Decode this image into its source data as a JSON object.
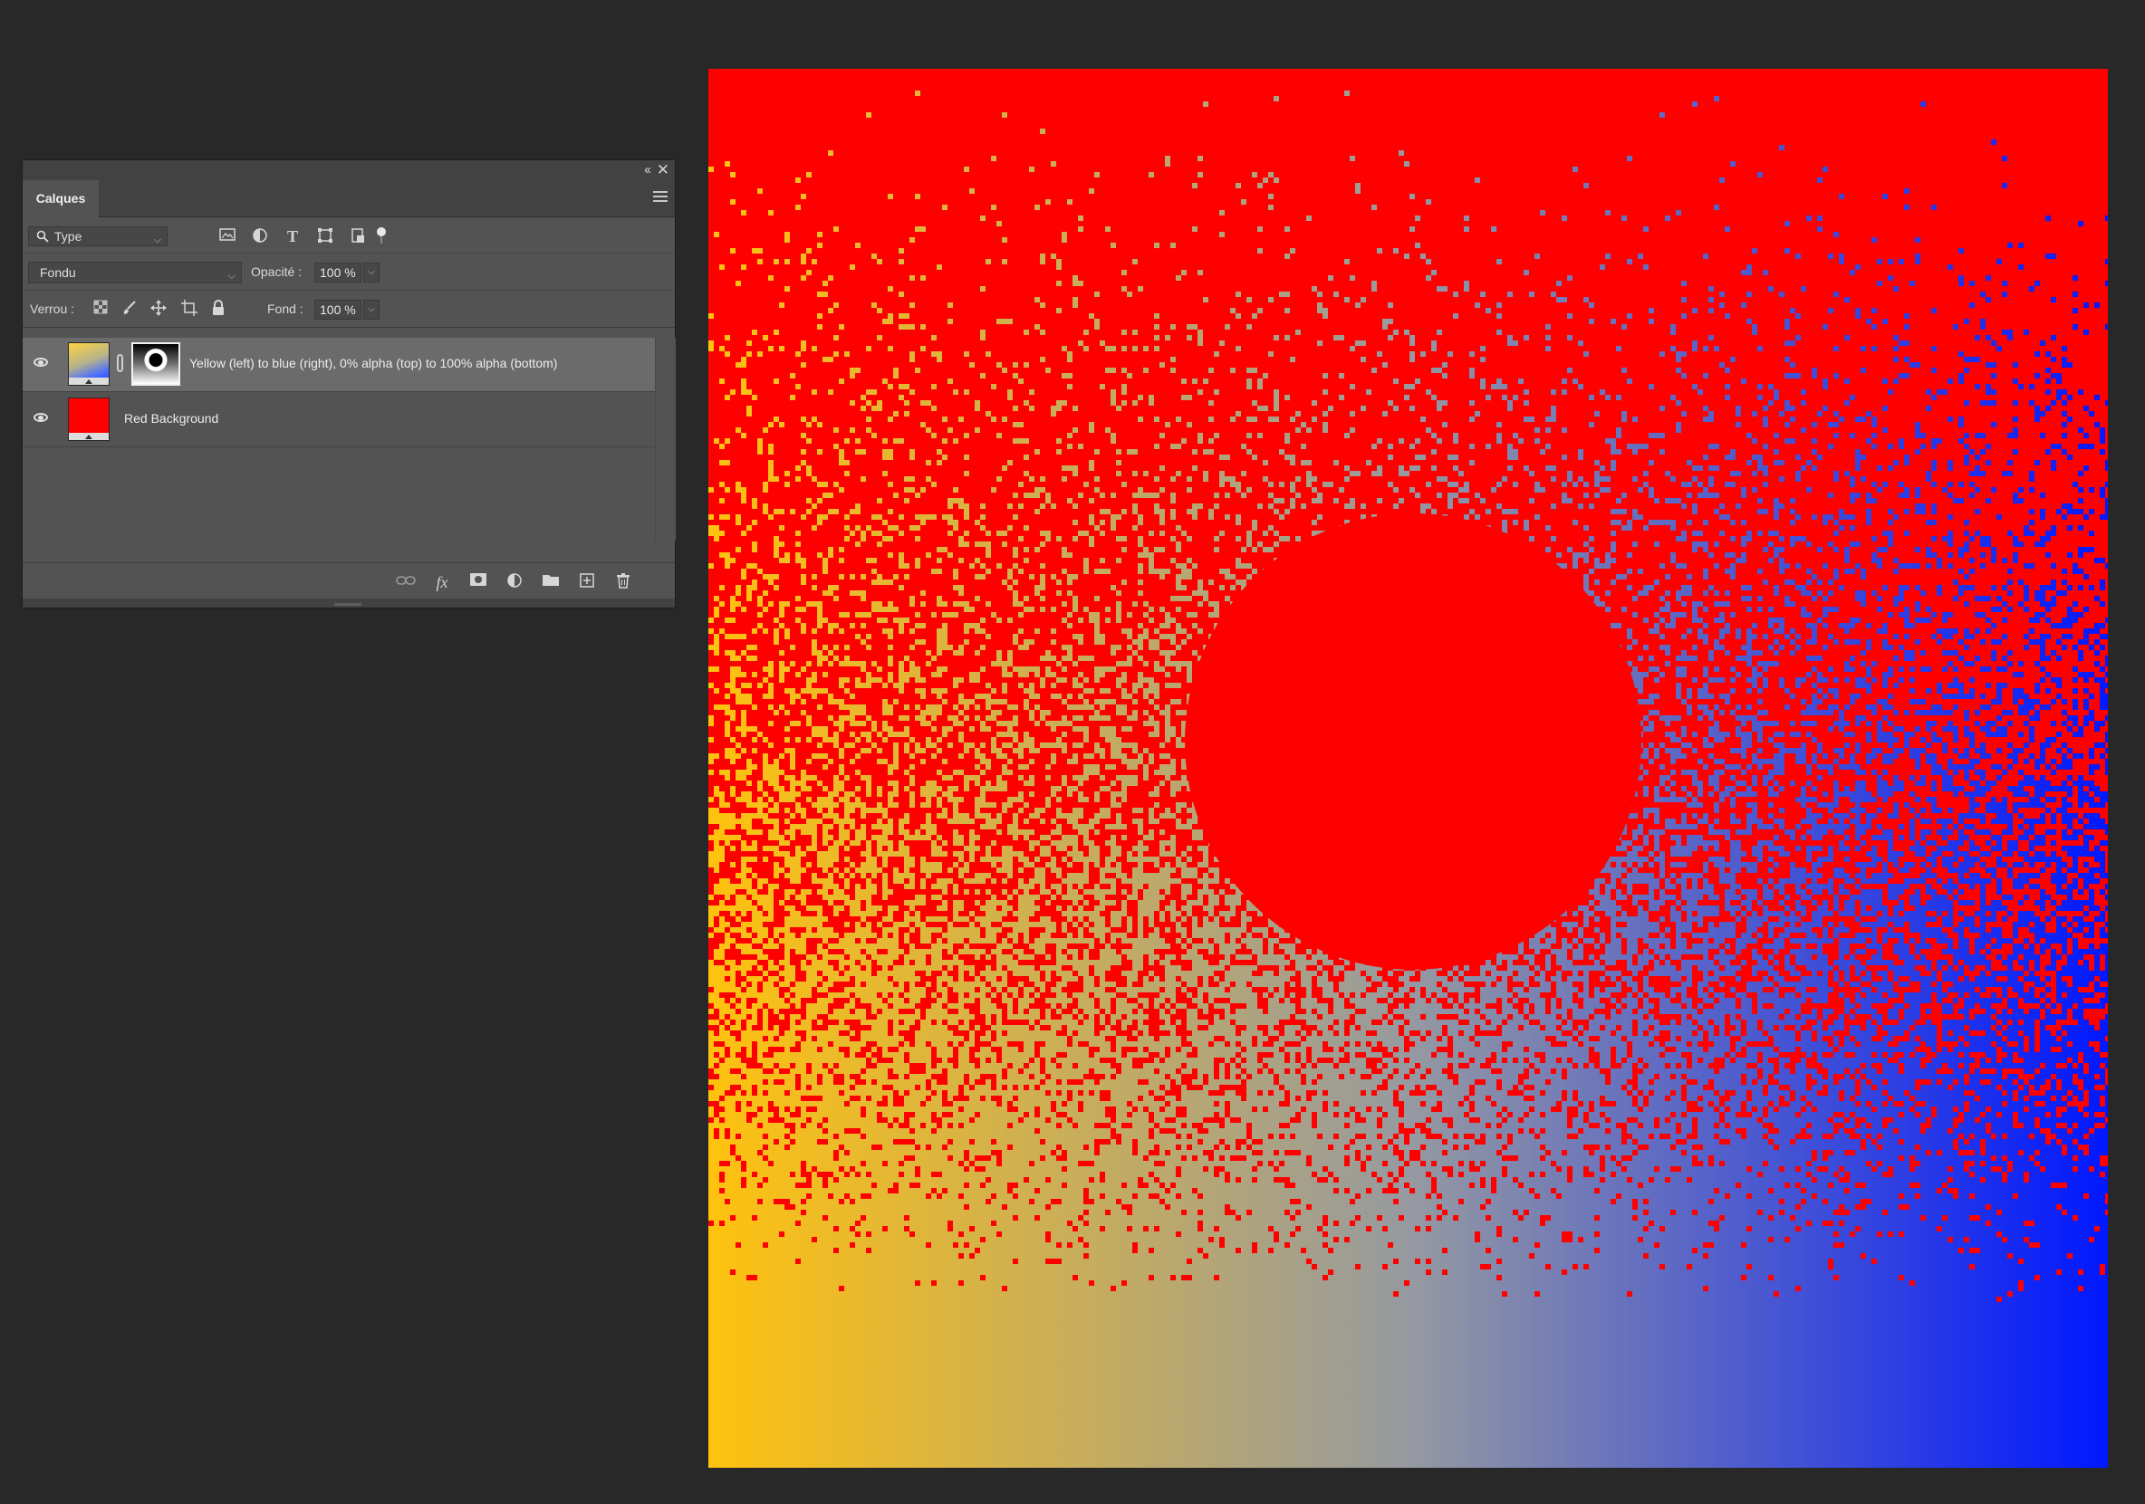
{
  "panel": {
    "tab_label": "Calques",
    "collapse_icon": "‹‹",
    "close_icon": "✕",
    "filter": {
      "kind_label": "Type",
      "icons": [
        "image-filter-icon",
        "adjustment-filter-icon",
        "type-filter-icon",
        "shape-filter-icon",
        "smart-object-filter-icon"
      ]
    },
    "blend": {
      "mode": "Fondu",
      "opacity_label": "Opacité :",
      "opacity_value": "100 %"
    },
    "lock": {
      "label": "Verrou :",
      "fill_label": "Fond :",
      "fill_value": "100 %",
      "icons": [
        "lock-transparent-icon",
        "lock-image-icon",
        "lock-position-icon",
        "lock-artboard-icon",
        "lock-all-icon"
      ]
    },
    "layers": [
      {
        "name": "Yellow (left) to blue (right), 0% alpha (top) to 100% alpha (bottom)",
        "visible": true,
        "selected": true,
        "has_mask": true
      },
      {
        "name": "Red Background",
        "visible": true,
        "selected": false,
        "has_mask": false
      }
    ],
    "footer_icons": [
      "link-layers-icon",
      "fx-icon",
      "add-mask-icon",
      "adjustment-layer-icon",
      "group-folder-icon",
      "new-layer-icon",
      "trash-icon"
    ]
  },
  "canvas": {
    "background_color": "#ff0000",
    "gradient_left_color": "#ffc20e",
    "gradient_mid_color": "#969aa0",
    "gradient_right_color": "#0018ff",
    "circle_color": "#ff0000"
  }
}
